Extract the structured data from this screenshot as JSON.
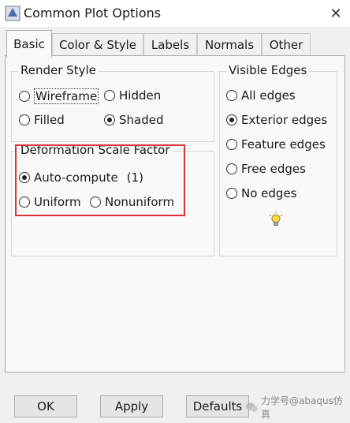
{
  "window": {
    "title": "Common Plot Options",
    "close_glyph": "✕"
  },
  "tabs": [
    {
      "label": "Basic",
      "active": true
    },
    {
      "label": "Color & Style",
      "active": false
    },
    {
      "label": "Labels",
      "active": false
    },
    {
      "label": "Normals",
      "active": false
    },
    {
      "label": "Other",
      "active": false
    }
  ],
  "render_style": {
    "title": "Render Style",
    "options": [
      {
        "label": "Wireframe",
        "selected": false
      },
      {
        "label": "Hidden",
        "selected": false
      },
      {
        "label": "Filled",
        "selected": false
      },
      {
        "label": "Shaded",
        "selected": true
      }
    ]
  },
  "deformation": {
    "title": "Deformation Scale Factor",
    "auto_label": "Auto-compute",
    "auto_value": "(1)",
    "options": [
      {
        "label": "Uniform",
        "selected": false
      },
      {
        "label": "Nonuniform",
        "selected": false
      }
    ]
  },
  "visible_edges": {
    "title": "Visible Edges",
    "options": [
      {
        "label": "All edges",
        "selected": false
      },
      {
        "label": "Exterior edges",
        "selected": true
      },
      {
        "label": "Feature edges",
        "selected": false
      },
      {
        "label": "Free edges",
        "selected": false
      },
      {
        "label": "No edges",
        "selected": false
      }
    ]
  },
  "buttons": {
    "ok": "OK",
    "apply": "Apply",
    "defaults": "Defaults"
  },
  "watermark": {
    "text": "力学号@abaqus仿真"
  },
  "colors": {
    "highlight": "#d9343a",
    "bulb": "#f5d94a"
  }
}
